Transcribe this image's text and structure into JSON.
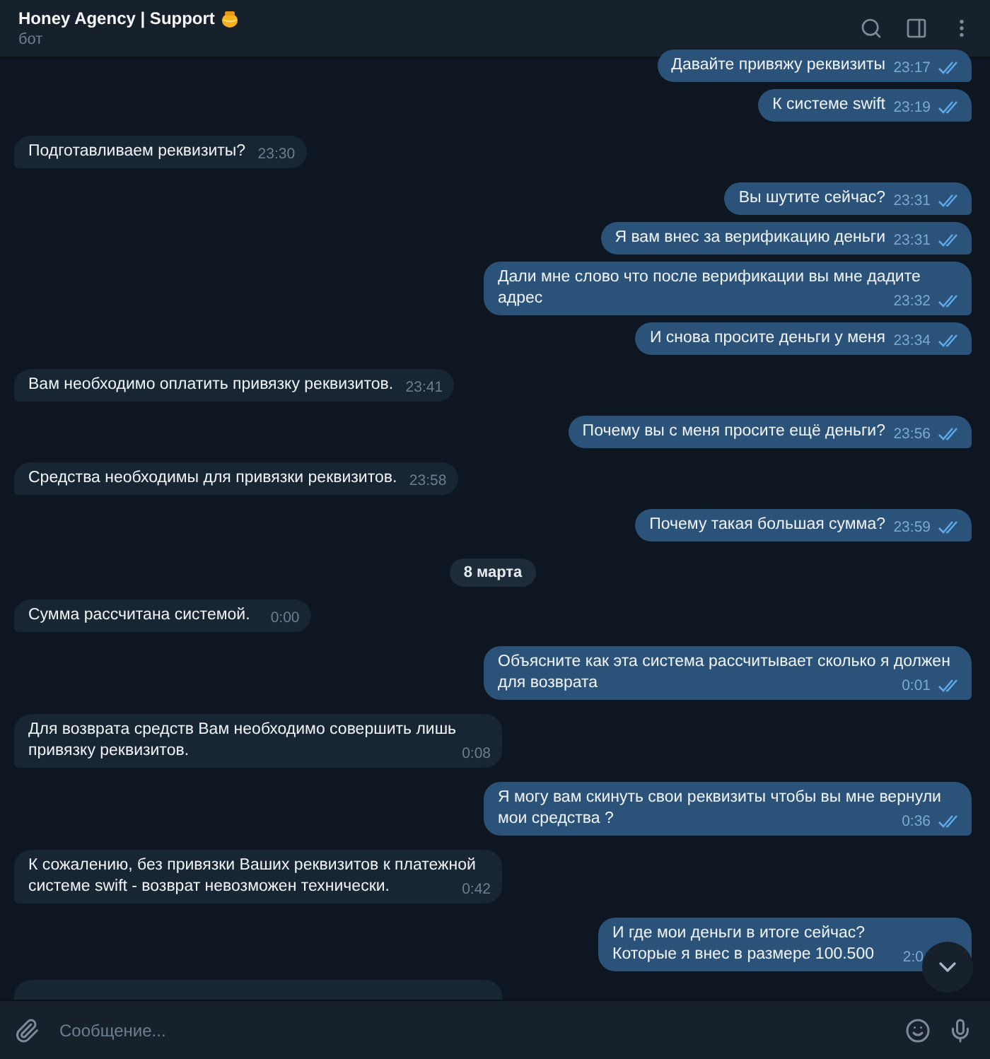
{
  "header": {
    "title": "Honey Agency | Support",
    "subtitle": "бот"
  },
  "messages": [
    {
      "kind": "outgoing",
      "text": "Давайте привяжу реквизиты",
      "time": "23:17",
      "read": true
    },
    {
      "kind": "outgoing",
      "text": "К системе swift",
      "time": "23:19",
      "read": true
    },
    {
      "kind": "incoming",
      "text": "Подготавливаем реквизиты?",
      "time": "23:30"
    },
    {
      "kind": "outgoing",
      "text": "Вы шутите сейчас?",
      "time": "23:31",
      "read": true
    },
    {
      "kind": "outgoing",
      "text": "Я вам внес за верификацию деньги",
      "time": "23:31",
      "read": true
    },
    {
      "kind": "outgoing",
      "text": "Дали мне слово что после верификации вы мне дадите адрес",
      "time": "23:32",
      "read": true
    },
    {
      "kind": "outgoing",
      "text": "И снова просите деньги у меня",
      "time": "23:34",
      "read": true
    },
    {
      "kind": "incoming",
      "text": "Вам необходимо оплатить привязку реквизитов.",
      "time": "23:41"
    },
    {
      "kind": "outgoing",
      "text": "Почему вы с меня просите ещё деньги?",
      "time": "23:56",
      "read": true
    },
    {
      "kind": "incoming",
      "text": "Средства необходимы для привязки реквизитов.",
      "time": "23:58"
    },
    {
      "kind": "outgoing",
      "text": "Почему такая большая сумма?",
      "time": "23:59",
      "read": true
    },
    {
      "kind": "date",
      "text": "8 марта"
    },
    {
      "kind": "incoming",
      "text": "Сумма рассчитана системой.",
      "time": "0:00"
    },
    {
      "kind": "outgoing",
      "text": "Объясните как эта система рассчитывает сколько я должен для возврата",
      "time": "0:01",
      "read": true
    },
    {
      "kind": "incoming",
      "text": "Для возврата средств Вам необходимо совершить лишь привязку реквизитов.",
      "time": "0:08"
    },
    {
      "kind": "outgoing",
      "text": "Я могу вам скинуть свои реквизиты чтобы вы мне вернули мои средства ?",
      "time": "0:36",
      "read": true
    },
    {
      "kind": "incoming",
      "text": "К сожалению, без привязки Ваших реквизитов к платежной системе swift - возврат невозможен технически.",
      "time": "0:42"
    },
    {
      "kind": "outgoing",
      "text": "И где мои деньги в итоге сейчас?\nКоторые я внес в размере 100.500",
      "time": "2:0"
    }
  ],
  "composer": {
    "placeholder": "Сообщение..."
  }
}
